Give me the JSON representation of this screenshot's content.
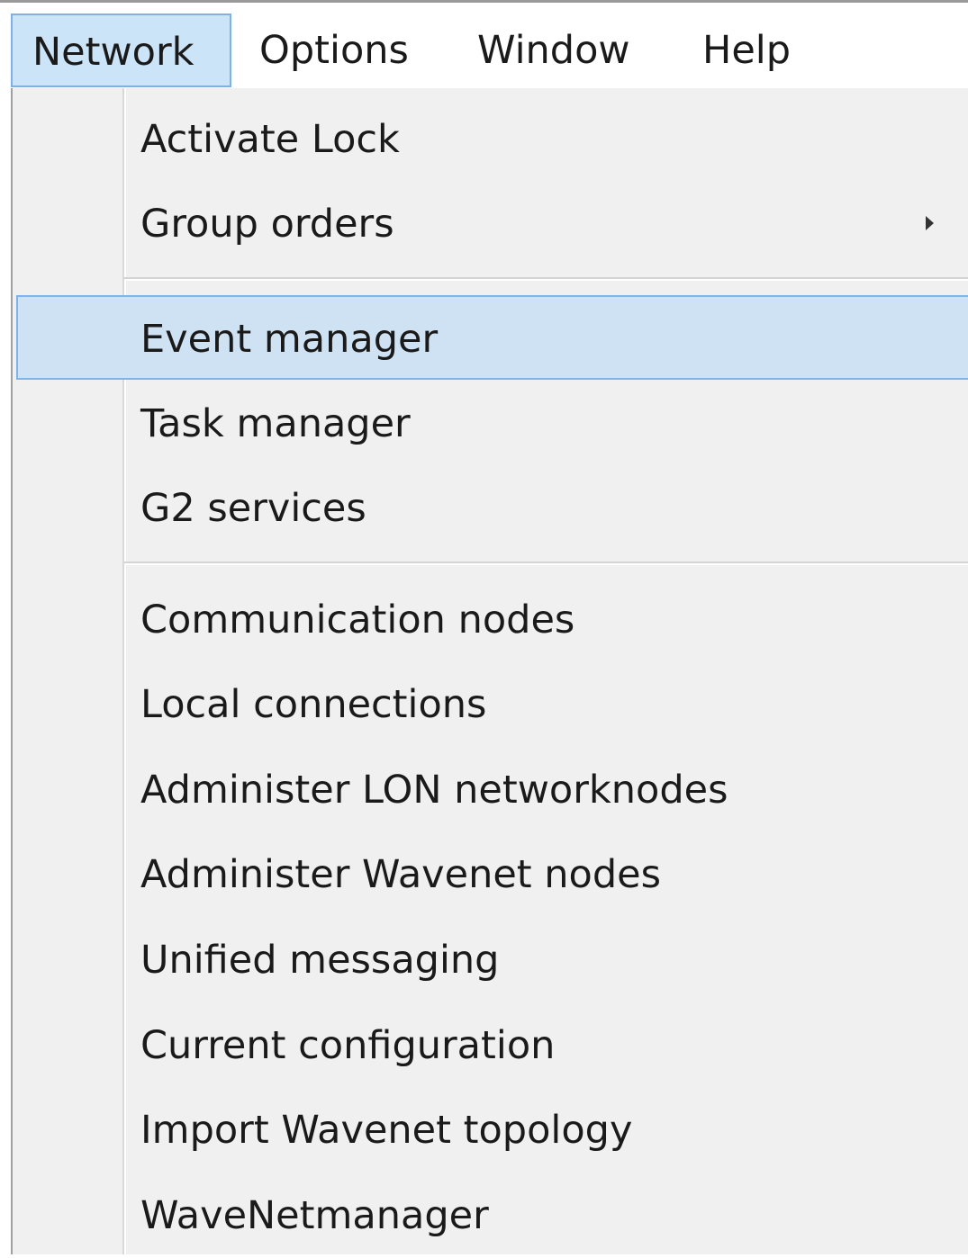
{
  "menubar": {
    "items": [
      {
        "label": "Network",
        "active": true
      },
      {
        "label": "Options",
        "active": false
      },
      {
        "label": "Window",
        "active": false
      },
      {
        "label": "Help",
        "active": false
      }
    ]
  },
  "dropdown": {
    "groups": [
      [
        {
          "label": "Activate Lock",
          "submenu": false
        },
        {
          "label": "Group orders",
          "submenu": true,
          "submenu_icon": "chevron-right-icon"
        }
      ],
      [
        {
          "label": "Event manager",
          "highlighted": true
        },
        {
          "label": "Task manager"
        },
        {
          "label": "G2 services"
        }
      ],
      [
        {
          "label": "Communication nodes"
        },
        {
          "label": "Local connections"
        },
        {
          "label": "Administer LON networknodes"
        },
        {
          "label": "Administer Wavenet nodes"
        },
        {
          "label": "Unified messaging"
        },
        {
          "label": "Current configuration"
        },
        {
          "label": "Import Wavenet topology"
        },
        {
          "label": "WaveNetmanager"
        }
      ]
    ]
  },
  "colors": {
    "highlight_bg": "#cfe2f4",
    "highlight_border": "#7eb4ea",
    "menu_bg": "#f0f0f0",
    "text": "#1a1a1a"
  }
}
